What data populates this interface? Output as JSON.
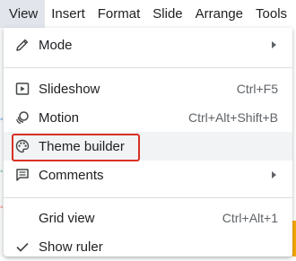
{
  "menubar": {
    "items": [
      {
        "label": "View"
      },
      {
        "label": "Insert"
      },
      {
        "label": "Format"
      },
      {
        "label": "Slide"
      },
      {
        "label": "Arrange"
      },
      {
        "label": "Tools"
      }
    ]
  },
  "menu": {
    "items": [
      {
        "label": "Mode",
        "shortcut": "",
        "icon": "pencil-icon",
        "submenu": true
      },
      {
        "label": "Slideshow",
        "shortcut": "Ctrl+F5",
        "icon": "slideshow-icon",
        "submenu": false
      },
      {
        "label": "Motion",
        "shortcut": "Ctrl+Alt+Shift+B",
        "icon": "motion-icon",
        "submenu": false
      },
      {
        "label": "Theme builder",
        "shortcut": "",
        "icon": "palette-icon",
        "submenu": false,
        "highlighted": true
      },
      {
        "label": "Comments",
        "shortcut": "",
        "icon": "comment-icon",
        "submenu": true
      },
      {
        "label": "Grid view",
        "shortcut": "Ctrl+Alt+1",
        "icon": "",
        "submenu": false
      },
      {
        "label": "Show ruler",
        "shortcut": "",
        "icon": "checkmark-icon",
        "submenu": false,
        "checked": true
      }
    ]
  },
  "colors": {
    "highlight_box": "#d93025",
    "active_menu_bg": "#e2e6ec",
    "hover_bg": "#f1f3f4",
    "text": "#202124",
    "shortcut_text": "#5f6368"
  }
}
